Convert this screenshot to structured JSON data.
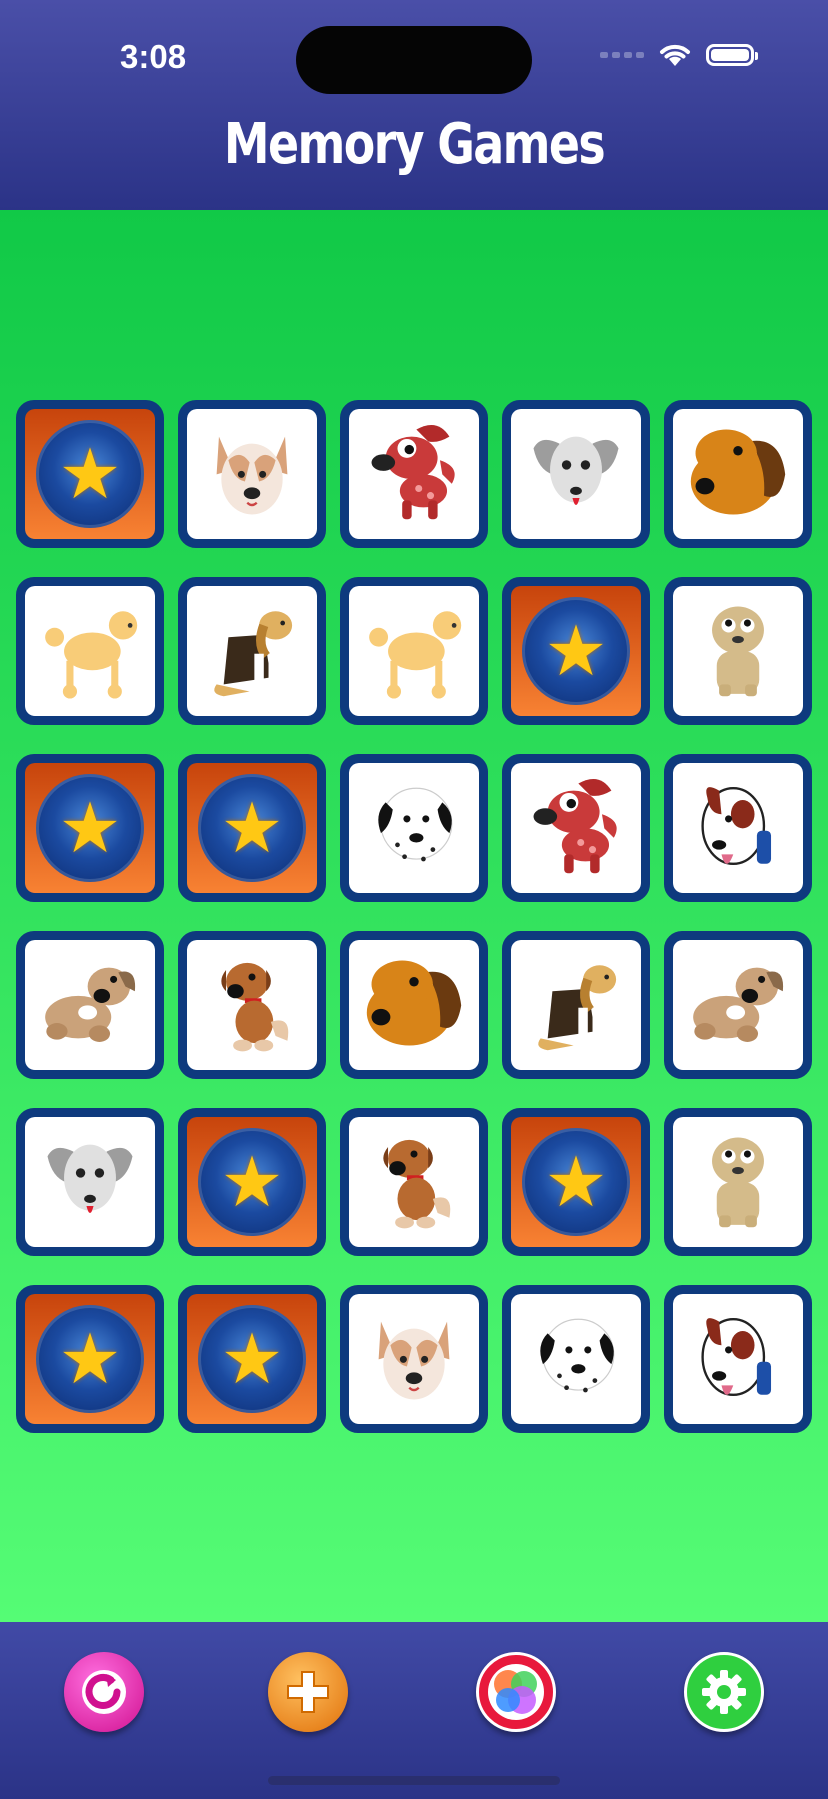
{
  "status": {
    "time": "3:08"
  },
  "header": {
    "title": "Memory Games"
  },
  "colors": {
    "header": "#2b3387",
    "board_top": "#11c947",
    "board_bottom": "#55fc75",
    "card_border": "#0e3a7e",
    "card_back": "#f88233",
    "star": "#ffc814"
  },
  "board": {
    "rows": [
      [
        "card-back",
        "terrier-face",
        "red-puppy",
        "gray-dog",
        "hound-face"
      ],
      [
        "poodle",
        "beagle",
        "poodle",
        "card-back",
        "pug-dog"
      ],
      [
        "card-back",
        "card-back",
        "dalmatian",
        "red-puppy",
        "bull-terrier"
      ],
      [
        "shaggy-dog",
        "brown-puppy",
        "hound-face",
        "beagle",
        "shaggy-dog"
      ],
      [
        "gray-dog",
        "card-back",
        "brown-puppy",
        "card-back",
        "pug-dog"
      ],
      [
        "card-back",
        "card-back",
        "terrier-face",
        "dalmatian",
        "bull-terrier"
      ]
    ]
  },
  "toolbar": {
    "buttons": [
      {
        "icon": "restart-icon",
        "color": "#e21fa8"
      },
      {
        "icon": "plus-icon",
        "color": "#f08a12"
      },
      {
        "icon": "game-center-icon",
        "color": "#e8193c"
      },
      {
        "icon": "gear-icon",
        "color": "#2fcf3f"
      }
    ]
  }
}
